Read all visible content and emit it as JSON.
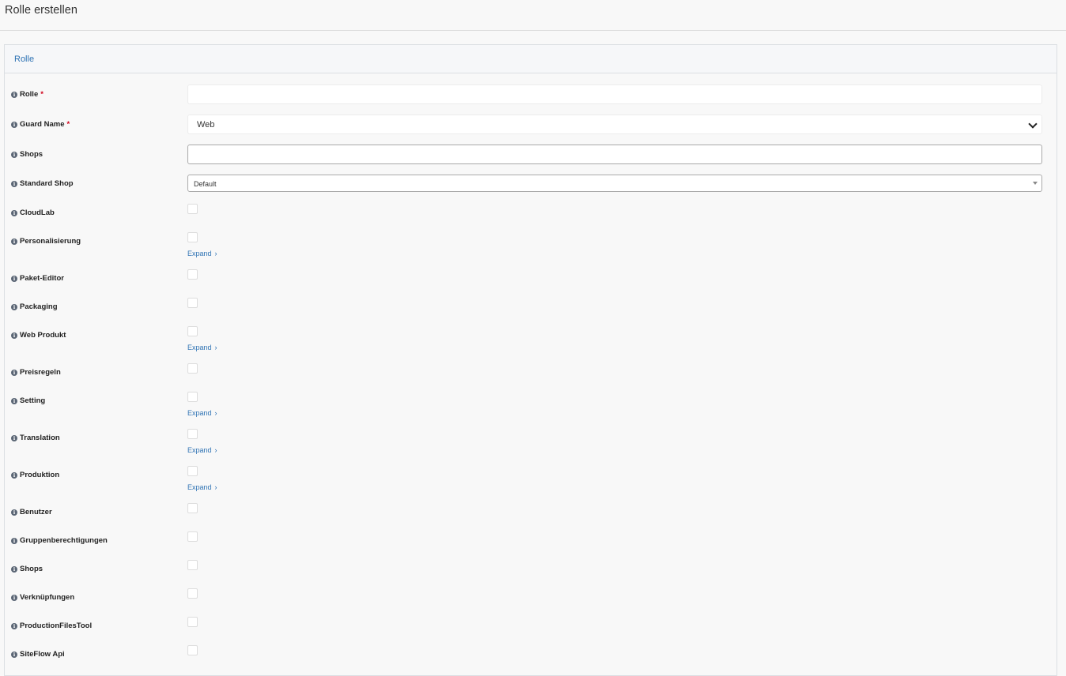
{
  "page": {
    "title": "Rolle erstellen"
  },
  "panel": {
    "title": "Rolle"
  },
  "fields": {
    "rolle": {
      "label": "Rolle",
      "required": "*",
      "value": ""
    },
    "guard_name": {
      "label": "Guard Name",
      "required": "*",
      "value": "Web"
    },
    "shops_input": {
      "label": "Shops",
      "value": ""
    },
    "standard_shop": {
      "label": "Standard Shop",
      "value": "Default"
    }
  },
  "permissions": [
    {
      "label": "CloudLab",
      "expand": ""
    },
    {
      "label": "Personalisierung",
      "expand": "Expand"
    },
    {
      "label": "Paket-Editor",
      "expand": ""
    },
    {
      "label": "Packaging",
      "expand": ""
    },
    {
      "label": "Web Produkt",
      "expand": "Expand"
    },
    {
      "label": "Preisregeln",
      "expand": ""
    },
    {
      "label": "Setting",
      "expand": "Expand"
    },
    {
      "label": "Translation",
      "expand": "Expand"
    },
    {
      "label": "Produktion",
      "expand": "Expand"
    },
    {
      "label": "Benutzer",
      "expand": ""
    },
    {
      "label": "Gruppenberechtigungen",
      "expand": ""
    },
    {
      "label": "Shops",
      "expand": ""
    },
    {
      "label": "Verknüpfungen",
      "expand": ""
    },
    {
      "label": "ProductionFilesTool",
      "expand": ""
    },
    {
      "label": "SiteFlow Api",
      "expand": ""
    }
  ],
  "icons": {
    "info": "info-icon",
    "chevron": "chevron-down-icon",
    "expand_arrow": "chevron-right-icon"
  },
  "colors": {
    "link": "#2f73b4",
    "required": "#d0021b"
  }
}
